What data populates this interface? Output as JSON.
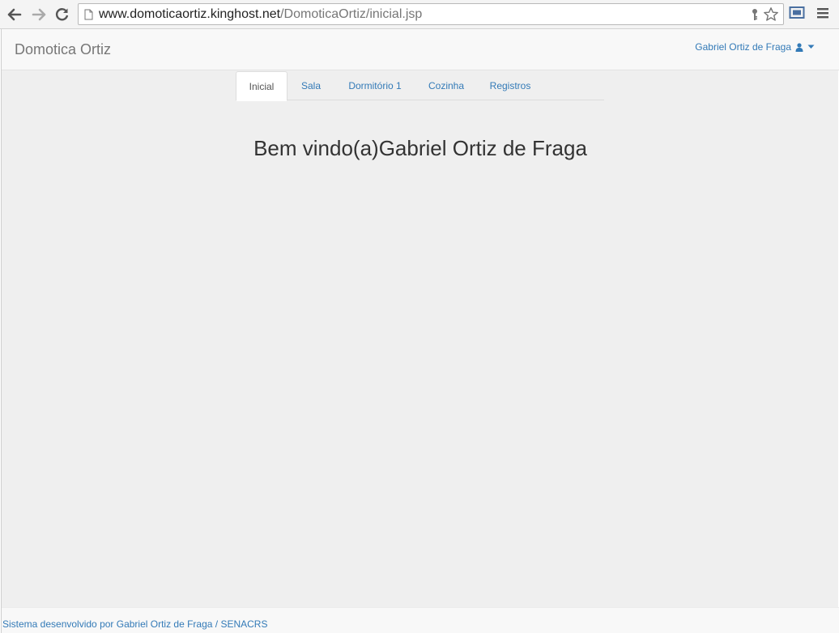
{
  "browser": {
    "url_host": "www.domoticaortiz.kinghost.net",
    "url_path": "/DomoticaOrtiz/inicial.jsp"
  },
  "navbar": {
    "brand": "Domotica Ortiz",
    "user_name": "Gabriel Ortiz de Fraga"
  },
  "tabs": [
    {
      "label": "Inicial",
      "active": true
    },
    {
      "label": "Sala",
      "active": false
    },
    {
      "label": "Dormitório 1",
      "active": false
    },
    {
      "label": "Cozinha",
      "active": false
    },
    {
      "label": "Registros",
      "active": false
    }
  ],
  "main": {
    "welcome": "Bem vindo(a)Gabriel Ortiz de Fraga"
  },
  "footer": {
    "text": "Sistema desenvolvido por Gabriel Ortiz de Fraga / SENACRS"
  },
  "colors": {
    "link": "#337ab7",
    "page_background": "#efefef",
    "navbar_background": "#f8f8f8"
  }
}
